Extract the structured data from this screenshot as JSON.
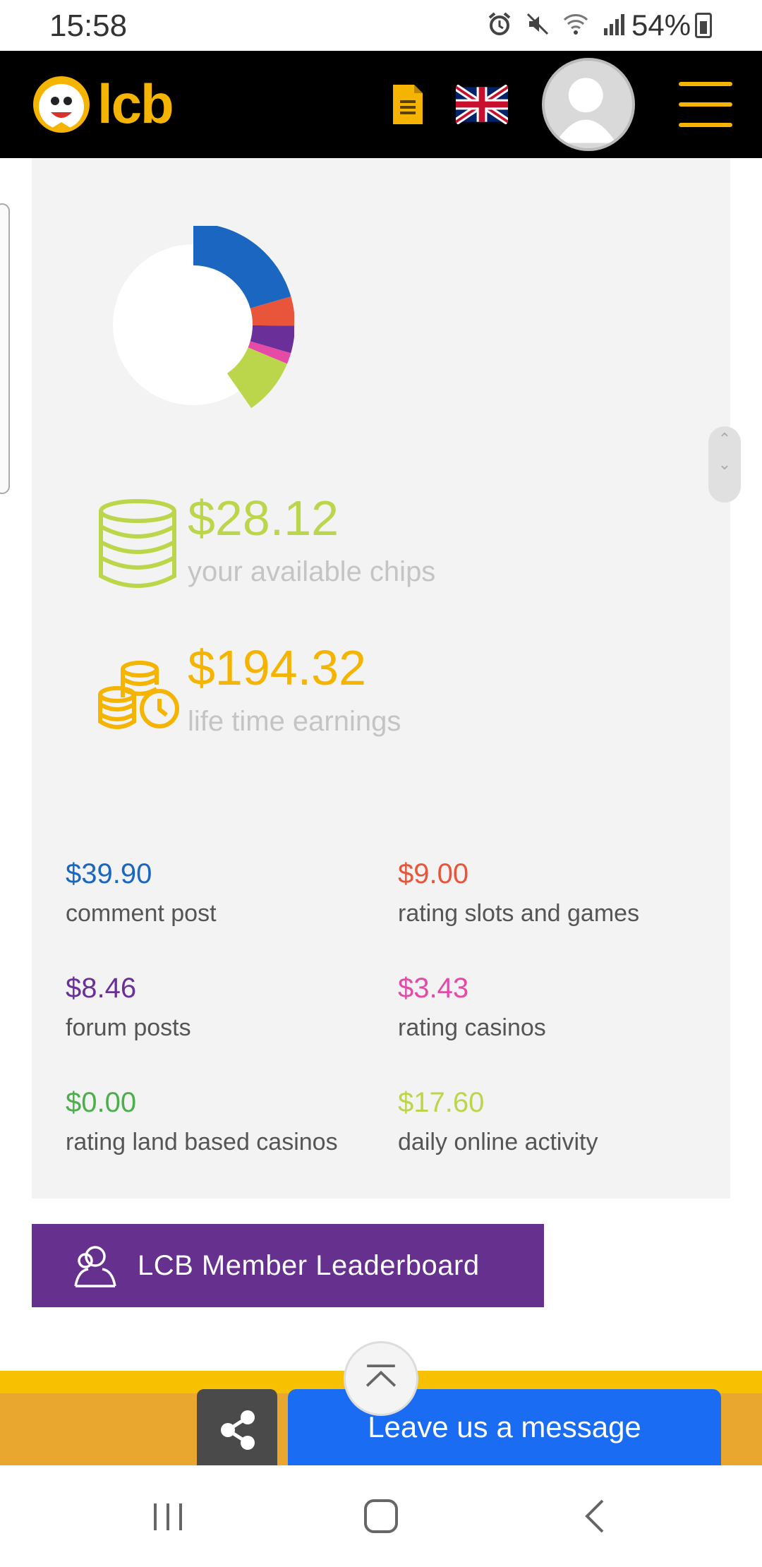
{
  "status_bar": {
    "time": "15:58",
    "battery": "54%",
    "icons": [
      "alarm-icon",
      "mute-icon",
      "wifi-icon",
      "signal-icon",
      "battery-icon"
    ]
  },
  "header": {
    "logo_text": "lcb",
    "icons": [
      "document-icon",
      "uk-flag-icon",
      "user-avatar-icon",
      "hamburger-menu-icon"
    ],
    "accent_color": "#f5b400"
  },
  "chart_data": {
    "type": "pie",
    "variant": "partial-donut",
    "slices": [
      {
        "value": 39.9,
        "color": "#1a66c0"
      },
      {
        "value": 9.0,
        "color": "#e9553a"
      },
      {
        "value": 8.46,
        "color": "#6b2f99"
      },
      {
        "value": 3.43,
        "color": "#e44aa6"
      },
      {
        "value": 0.0,
        "color": "#4cae4c"
      },
      {
        "value": 17.6,
        "color": "#bcd64c"
      }
    ],
    "total": 194.32
  },
  "summary": {
    "chips_amount": "$28.12",
    "chips_label": "your available chips",
    "earnings_amount": "$194.32",
    "earnings_label": "life time earnings",
    "chips_color": "#bcd64c",
    "earnings_color": "#f5b400"
  },
  "stats": [
    {
      "amount": "$39.90",
      "label": "comment post",
      "color": "#1a66c0"
    },
    {
      "amount": "$9.00",
      "label": "rating slots and games",
      "color": "#e9553a"
    },
    {
      "amount": "$8.46",
      "label": "forum posts",
      "color": "#6b2f99"
    },
    {
      "amount": "$3.43",
      "label": "rating casinos",
      "color": "#e44aa6"
    },
    {
      "amount": "$0.00",
      "label": "rating land based casinos",
      "color": "#4cae4c"
    },
    {
      "amount": "$17.60",
      "label": "daily online activity",
      "color": "#bcd64c"
    }
  ],
  "leaderboard": {
    "label": "LCB Member Leaderboard",
    "color": "#66308f"
  },
  "bottom": {
    "message_label": "Leave us a message",
    "message_color": "#1a6cf2",
    "icons": [
      "share-icon",
      "scroll-to-top-icon"
    ]
  },
  "nav": {
    "icons": [
      "recent-apps-icon",
      "home-icon",
      "back-icon"
    ]
  }
}
